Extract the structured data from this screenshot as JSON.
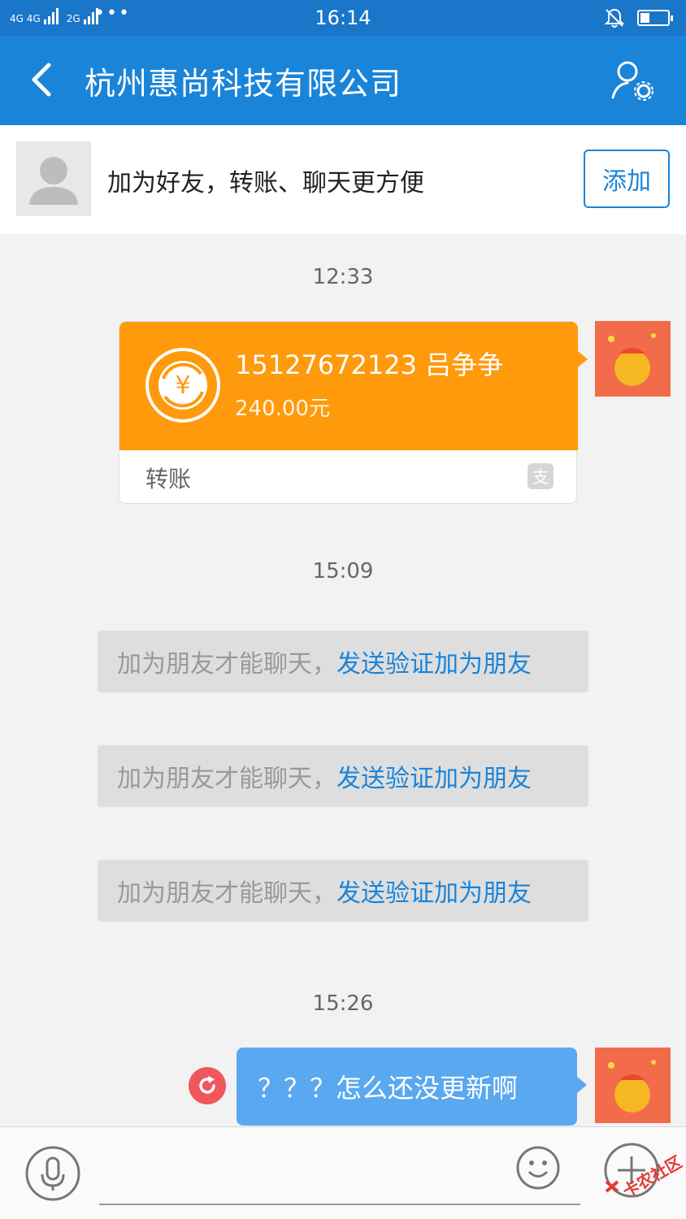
{
  "status_bar": {
    "network": "4G 4G",
    "network2": "2G",
    "time": "16:14",
    "battery_level": 0.35
  },
  "header": {
    "title": "杭州惠尚科技有限公司",
    "back_icon": "chevron-left-icon",
    "profile_icon": "user-settings-icon"
  },
  "banner": {
    "text": "加为好友，转账、聊天更方便",
    "add_label": "添加"
  },
  "messages": [
    {
      "time": "12:33"
    },
    {
      "type": "transfer",
      "name": "15127672123 吕争争",
      "amount": "240.00元",
      "footer": "转账"
    },
    {
      "time": "15:09"
    },
    {
      "type": "system",
      "prefix": "加为朋友才能聊天，",
      "link": "发送验证加为朋友"
    },
    {
      "type": "system",
      "prefix": "加为朋友才能聊天，",
      "link": "发送验证加为朋友"
    },
    {
      "type": "system",
      "prefix": "加为朋友才能聊天，",
      "link": "发送验证加为朋友"
    },
    {
      "time": "15:26"
    },
    {
      "type": "text",
      "text": "？？？怎么还没更新啊"
    }
  ],
  "input_bar": {
    "placeholder": "",
    "watermark": "卡农社区"
  },
  "colors": {
    "header_blue": "#1a84d8",
    "transfer_orange": "#fe9a0c",
    "bubble_blue": "#59a8f0",
    "link_blue": "#1a84d8"
  }
}
